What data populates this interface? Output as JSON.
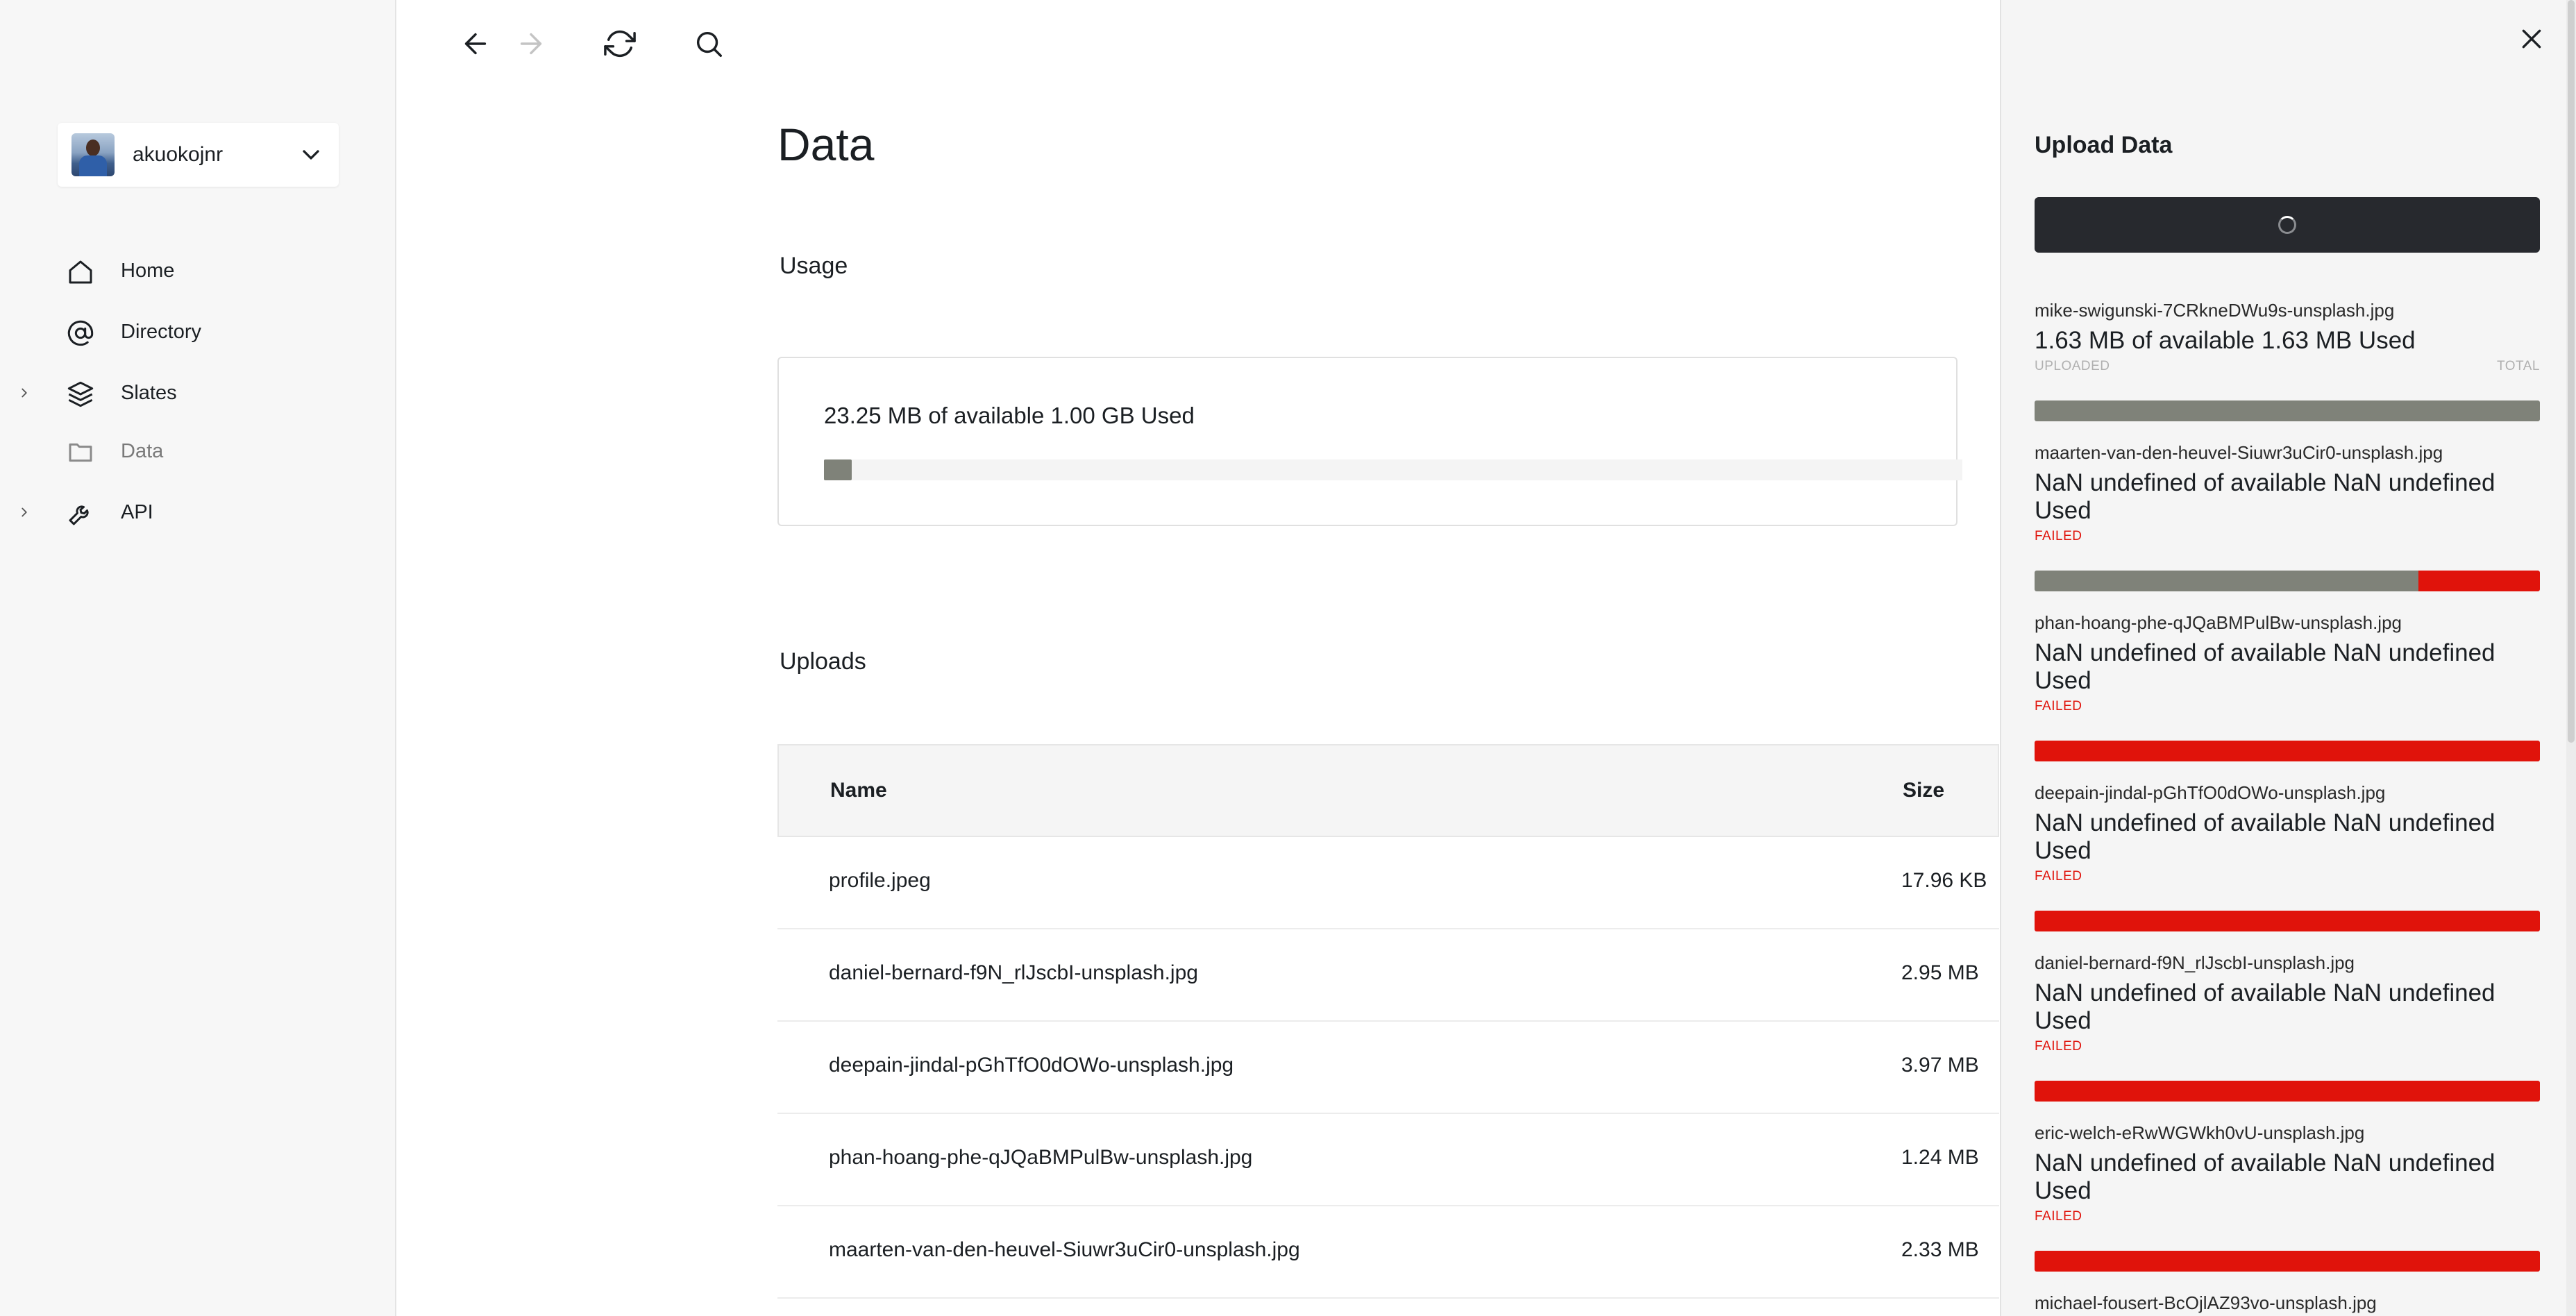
{
  "sidebar": {
    "account": {
      "username": "akuokojnr"
    },
    "items": [
      {
        "label": "Home",
        "icon": "home-icon",
        "expandable": false,
        "active": false
      },
      {
        "label": "Directory",
        "icon": "at-icon",
        "expandable": false,
        "active": false
      },
      {
        "label": "Slates",
        "icon": "layers-icon",
        "expandable": true,
        "active": false
      },
      {
        "label": "Data",
        "icon": "folder-icon",
        "expandable": false,
        "active": true
      },
      {
        "label": "API",
        "icon": "wrench-icon",
        "expandable": true,
        "active": false
      }
    ]
  },
  "toolbar": {
    "icons": [
      "back-arrow-icon",
      "forward-arrow-icon",
      "refresh-icon",
      "search-icon"
    ]
  },
  "main": {
    "title": "Data",
    "usage": {
      "heading": "Usage",
      "text": "23.25 MB of available 1.00 GB Used",
      "fraction_used": 0.0227
    },
    "uploads": {
      "heading": "Uploads",
      "columns": [
        "Name",
        "Size"
      ],
      "rows": [
        {
          "name": "profile.jpeg",
          "size": "17.96 KB"
        },
        {
          "name": "daniel-bernard-f9N_rlJscbI-unsplash.jpg",
          "size": "2.95 MB"
        },
        {
          "name": "deepain-jindal-pGhTfO0dOWo-unsplash.jpg",
          "size": "3.97 MB"
        },
        {
          "name": "phan-hoang-phe-qJQaBMPulBw-unsplash.jpg",
          "size": "1.24 MB"
        },
        {
          "name": "maarten-van-den-heuvel-Siuwr3uCir0-unsplash.jpg",
          "size": "2.33 MB"
        }
      ]
    }
  },
  "upload_panel": {
    "title": "Upload Data",
    "items": [
      {
        "file": "mike-swigunski-7CRkneDWu9s-unsplash.jpg",
        "size_text": "1.63 MB of available 1.63 MB Used",
        "status": "UPLOADED",
        "total_label": "TOTAL",
        "progress": 1.0,
        "failed_fraction": 0.0
      },
      {
        "file": "maarten-van-den-heuvel-Siuwr3uCir0-unsplash.jpg",
        "size_text": "NaN undefined of available NaN undefined Used",
        "status": "FAILED",
        "total_label": "",
        "progress": 0.76,
        "failed_fraction": 0.24
      },
      {
        "file": "phan-hoang-phe-qJQaBMPulBw-unsplash.jpg",
        "size_text": "NaN undefined of available NaN undefined Used",
        "status": "FAILED",
        "total_label": "",
        "progress": 0.0,
        "failed_fraction": 1.0
      },
      {
        "file": "deepain-jindal-pGhTfO0dOWo-unsplash.jpg",
        "size_text": "NaN undefined of available NaN undefined Used",
        "status": "FAILED",
        "total_label": "",
        "progress": 0.0,
        "failed_fraction": 1.0
      },
      {
        "file": "daniel-bernard-f9N_rlJscbI-unsplash.jpg",
        "size_text": "NaN undefined of available NaN undefined Used",
        "status": "FAILED",
        "total_label": "",
        "progress": 0.0,
        "failed_fraction": 1.0
      },
      {
        "file": "eric-welch-eRwWGWkh0vU-unsplash.jpg",
        "size_text": "NaN undefined of available NaN undefined Used",
        "status": "FAILED",
        "total_label": "",
        "progress": 0.0,
        "failed_fraction": 1.0
      },
      {
        "file": "michael-fousert-BcOjlAZ93vo-unsplash.jpg",
        "size_text": "",
        "status": "",
        "total_label": "",
        "progress": 0.0,
        "failed_fraction": 0.0
      }
    ]
  },
  "colors": {
    "progress_gray": "#7f8279",
    "failed_red": "#e0130b",
    "uploaded_gray": "#b0b0b0",
    "button_dark": "#27292e"
  }
}
